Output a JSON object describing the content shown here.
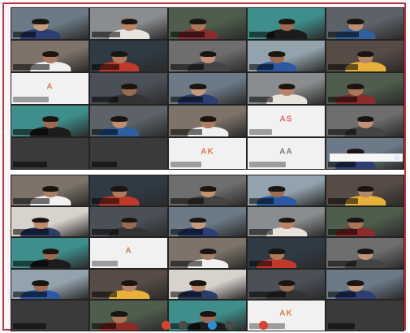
{
  "meeting": {
    "upper_panel": {
      "avatar_tiles": [
        {
          "key": "r2c0",
          "initials": "A",
          "color": "#e07a4a"
        },
        {
          "key": "r3c3",
          "initials": "AS",
          "color": "#e06a6a"
        },
        {
          "key": "r4c2",
          "initials": "AK",
          "color": "#e07a4a"
        },
        {
          "key": "r4c3",
          "initials": "AA",
          "color": "#7a7a7a"
        }
      ]
    },
    "lower_panel": {
      "avatar_tiles": [
        {
          "key": "r2c1",
          "initials": "A",
          "color": "#e07a4a"
        },
        {
          "key": "r4c3",
          "initials": "AK",
          "color": "#e07a4a"
        }
      ]
    },
    "toolbar": {
      "buttons": [
        {
          "name": "mic-icon",
          "color": "#d9432f"
        },
        {
          "name": "camera-icon",
          "color": "#4a4a4a"
        },
        {
          "name": "share-icon",
          "color": "#2a8fd6"
        },
        {
          "name": "more-icon",
          "color": "#4a4a4a"
        },
        {
          "name": "end-call-icon",
          "color": "#d9432f"
        }
      ]
    }
  }
}
